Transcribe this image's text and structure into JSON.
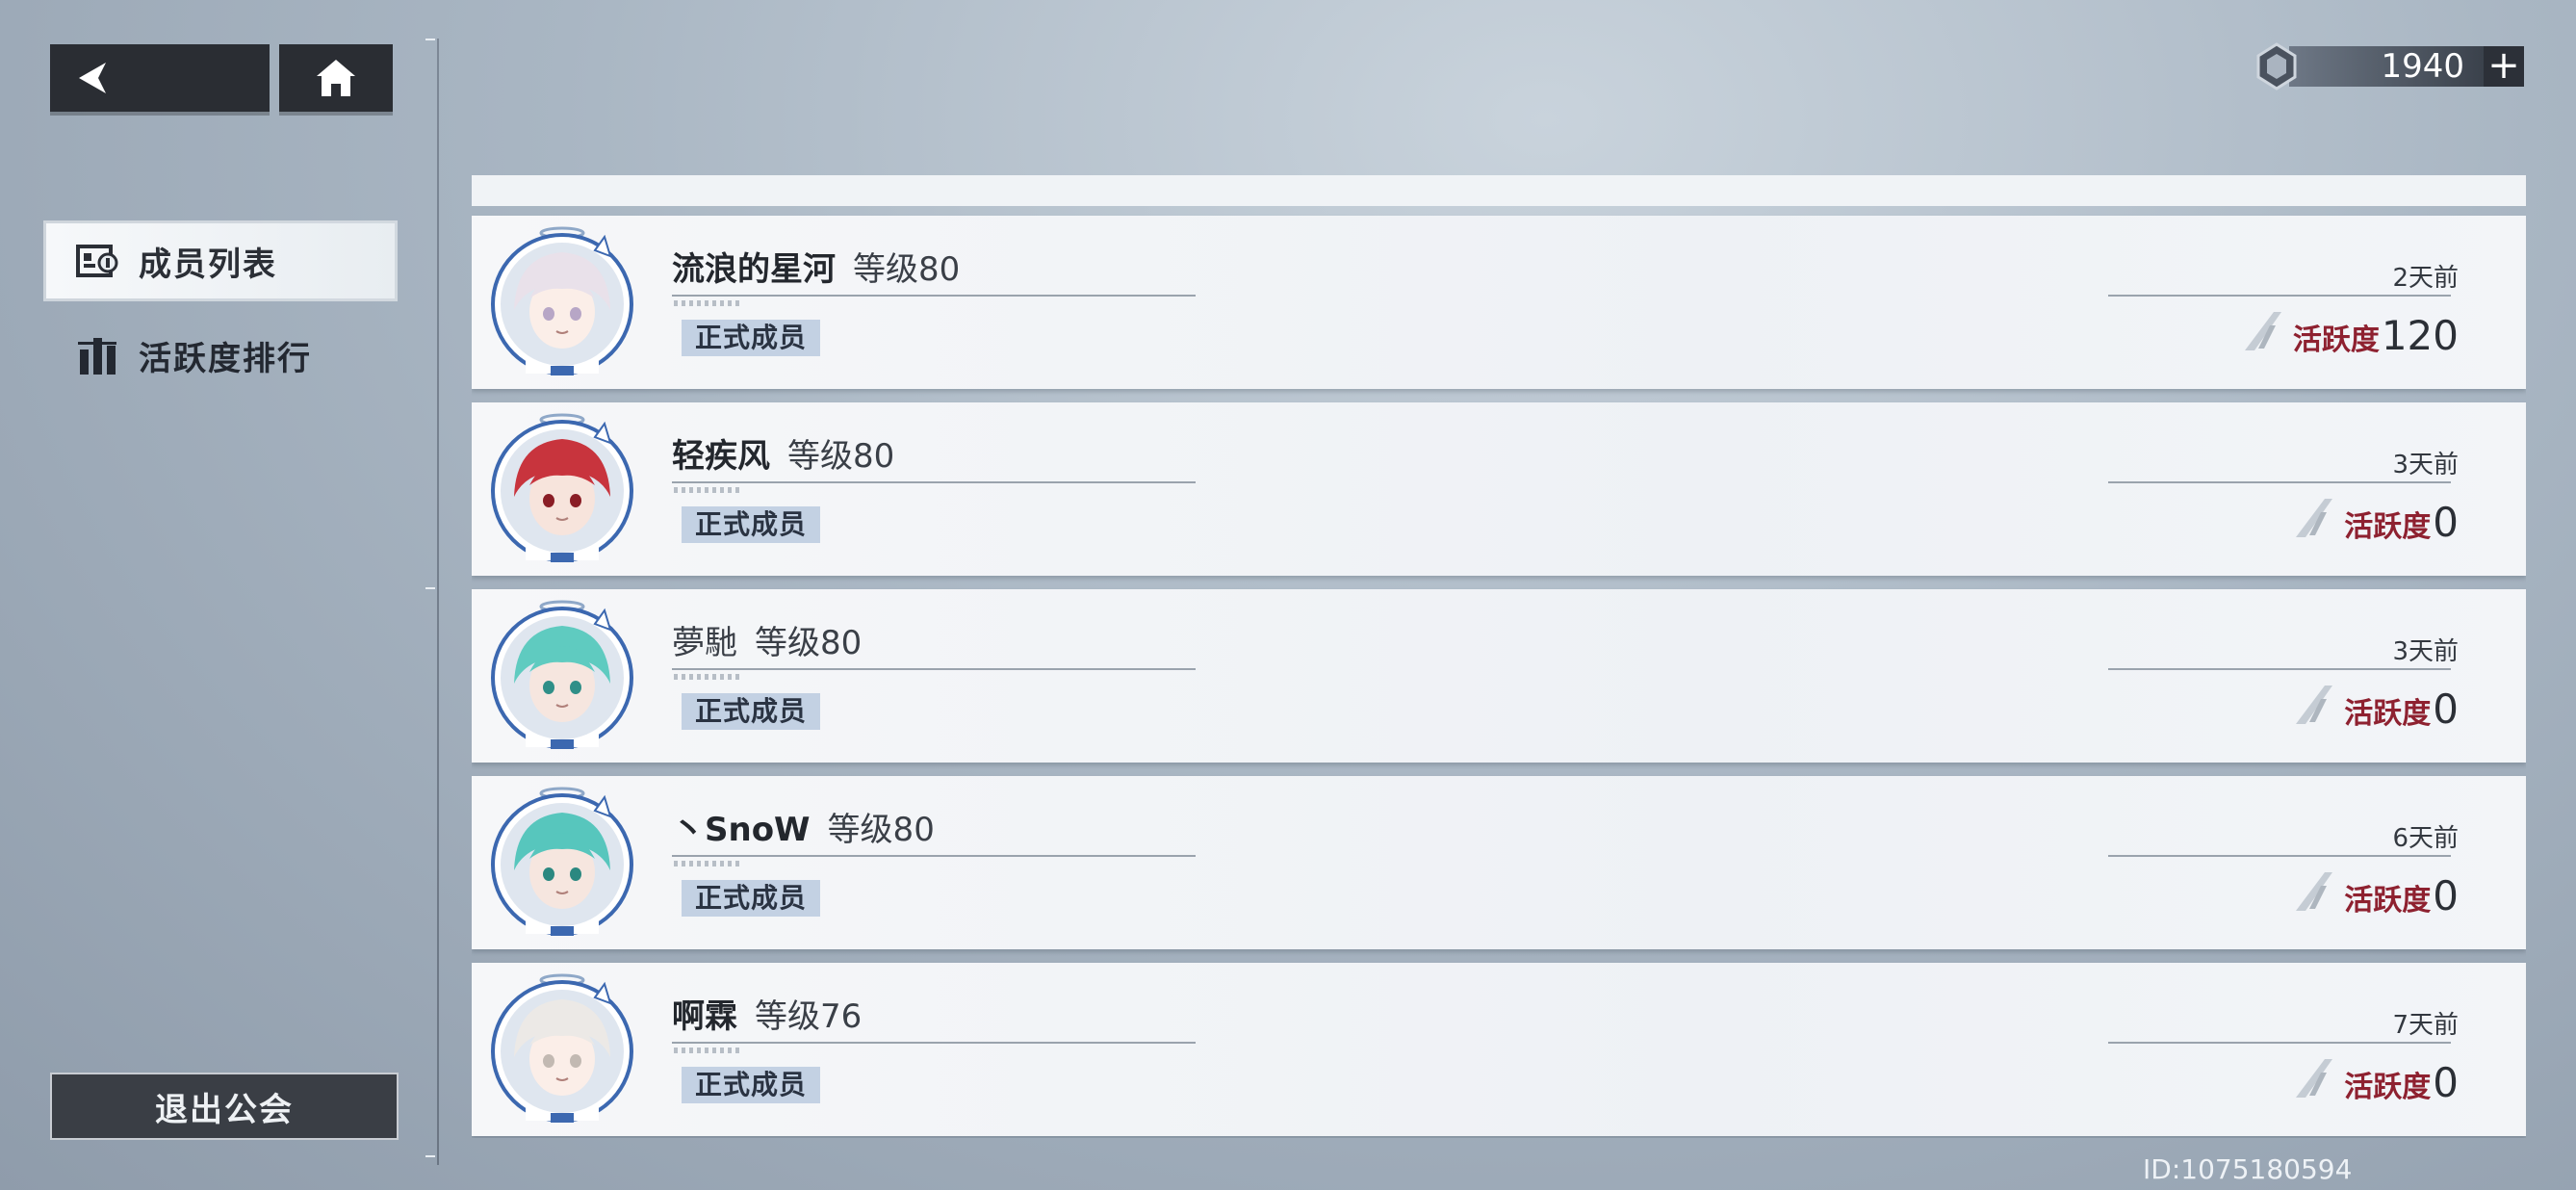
{
  "currency": {
    "amount": "1940",
    "plus_label": "+"
  },
  "sidebar": {
    "items": [
      {
        "label": "成员列表",
        "icon": "member-card-icon",
        "selected": true
      },
      {
        "label": "活跃度排行",
        "icon": "ranking-bars-icon",
        "selected": false
      }
    ],
    "exit_label": "退出公会"
  },
  "members": [
    {
      "name": "流浪的星河",
      "level": "等级80",
      "role": "正式成员",
      "last_seen": "2天前",
      "activity_label": "活跃度",
      "activity": "120",
      "name_bold": true
    },
    {
      "name": "轻疾风",
      "level": "等级80",
      "role": "正式成员",
      "last_seen": "3天前",
      "activity_label": "活跃度",
      "activity": "0",
      "name_bold": true
    },
    {
      "name": "夢馳",
      "level": "等级80",
      "role": "正式成员",
      "last_seen": "3天前",
      "activity_label": "活跃度",
      "activity": "0",
      "name_bold": false
    },
    {
      "name": "丶SnoW",
      "level": "等级80",
      "role": "正式成员",
      "last_seen": "6天前",
      "activity_label": "活跃度",
      "activity": "0",
      "name_bold": true
    },
    {
      "name": "啊霖",
      "level": "等级76",
      "role": "正式成员",
      "last_seen": "7天前",
      "activity_label": "活跃度",
      "activity": "0",
      "name_bold": true
    }
  ],
  "footer": {
    "user_id": "ID:1075180594"
  },
  "colors": {
    "activity_label": "#8e2130",
    "role_badge": "#c3d1e3",
    "dark_button": "#2a2d33"
  }
}
